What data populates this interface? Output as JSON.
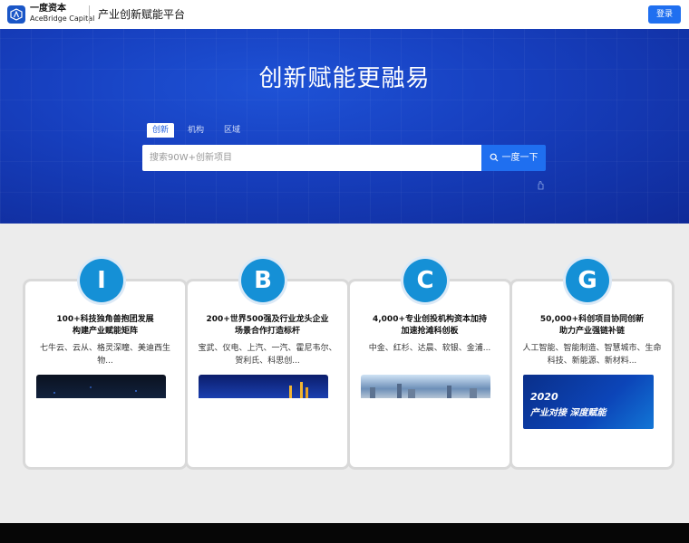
{
  "header": {
    "brand_cn": "一度资本",
    "brand_en": "AceBridge Capital",
    "platform": "产业创新赋能平台",
    "login_label": "登录",
    "logo_icon": "acebridge-logo-icon"
  },
  "hero": {
    "title": "创新赋能更融易",
    "tabs": [
      {
        "label": "创新",
        "active": true
      },
      {
        "label": "机构",
        "active": false
      },
      {
        "label": "区域",
        "active": false
      }
    ],
    "search": {
      "placeholder": "搜索90W+创新项目",
      "value": "",
      "button_label": "一度一下",
      "button_icon": "search-icon"
    }
  },
  "cards": [
    {
      "letter": "I",
      "title_line1": "100+科技独角兽抱团发展",
      "title_line2": "构建产业赋能矩阵",
      "desc_line1": "七牛云、云从、格灵深瞳、美迪西生",
      "desc_line2": "物..."
    },
    {
      "letter": "B",
      "title_line1": "200+世界500强及行业龙头企业",
      "title_line2": "场景合作打造标杆",
      "desc_line1": "宝武、仪电、上汽、一汽、霍尼韦尔、",
      "desc_line2": "贺利氏、科思创..."
    },
    {
      "letter": "C",
      "title_line1": "4,000+专业创投机构资本加持",
      "title_line2": "加速抢滩科创板",
      "desc_line1": "中金、红杉、达晨、软银、金浦...",
      "desc_line2": ""
    },
    {
      "letter": "G",
      "title_line1": "50,000+科创项目协同创新",
      "title_line2": "助力产业强链补链",
      "desc_line1": "人工智能、智能制造、智慧城市、生命",
      "desc_line2": "科技、新能源、新材料...",
      "image_year": "2020",
      "image_slogan": "产业对接 深度赋能"
    }
  ],
  "colors": {
    "accent": "#1f6ff0",
    "circle": "#1590d6",
    "hero_dark": "#0f2a98"
  }
}
